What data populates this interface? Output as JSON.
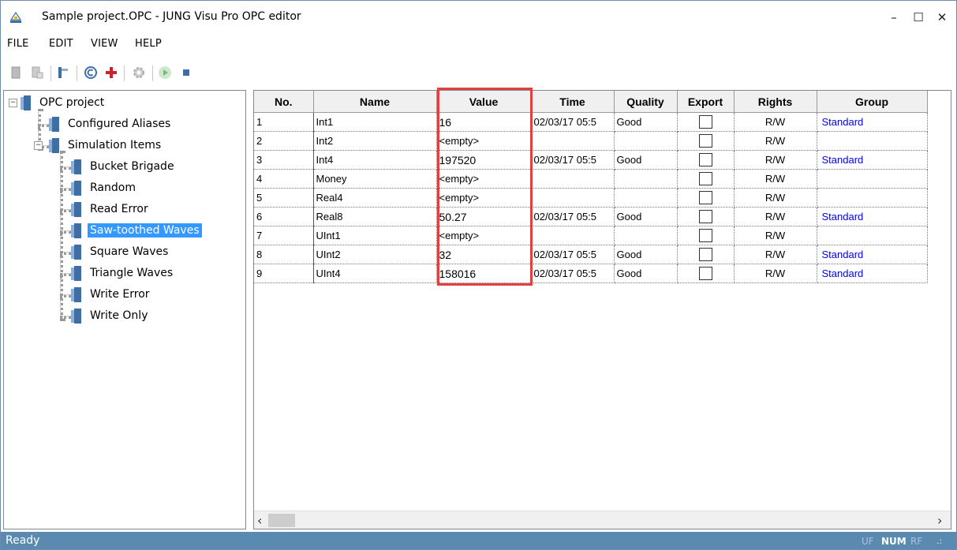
{
  "window": {
    "title": "Sample project.OPC - JUNG Visu Pro OPC editor",
    "minimize": "–",
    "maximize": "☐",
    "close": "✕"
  },
  "menu": [
    "FILE",
    "EDIT",
    "VIEW",
    "HELP"
  ],
  "toolbar": {
    "icons": [
      "new-icon",
      "open-icon",
      "save-icon",
      "copyright-icon",
      "add-icon",
      "settings-icon",
      "play-icon",
      "stop-icon"
    ]
  },
  "tree": {
    "root": "OPC project",
    "configured": "Configured Aliases",
    "simulation": "Simulation Items",
    "children": [
      "Bucket Brigade",
      "Random",
      "Read Error",
      "Saw-toothed Waves",
      "Square Waves",
      "Triangle Waves",
      "Write Error",
      "Write Only"
    ],
    "selected": "Saw-toothed Waves"
  },
  "table": {
    "columns": [
      "No.",
      "Name",
      "Value",
      "Time",
      "Quality",
      "Export",
      "Rights",
      "Group"
    ],
    "rows": [
      {
        "no": "1",
        "name": "Int1",
        "value": "16",
        "time": "02/03/17 05:5",
        "quality": "Good",
        "rights": "R/W",
        "group": "Standard"
      },
      {
        "no": "2",
        "name": "Int2",
        "value": "<empty>",
        "time": "",
        "quality": "",
        "rights": "R/W",
        "group": ""
      },
      {
        "no": "3",
        "name": "Int4",
        "value": "197520",
        "time": "02/03/17 05:5",
        "quality": "Good",
        "rights": "R/W",
        "group": "Standard"
      },
      {
        "no": "4",
        "name": "Money",
        "value": "<empty>",
        "time": "",
        "quality": "",
        "rights": "R/W",
        "group": ""
      },
      {
        "no": "5",
        "name": "Real4",
        "value": "<empty>",
        "time": "",
        "quality": "",
        "rights": "R/W",
        "group": ""
      },
      {
        "no": "6",
        "name": "Real8",
        "value": "50.27",
        "time": "02/03/17 05:5",
        "quality": "Good",
        "rights": "R/W",
        "group": "Standard"
      },
      {
        "no": "7",
        "name": "UInt1",
        "value": "<empty>",
        "time": "",
        "quality": "",
        "rights": "R/W",
        "group": ""
      },
      {
        "no": "8",
        "name": "UInt2",
        "value": "32",
        "time": "02/03/17 05:5",
        "quality": "Good",
        "rights": "R/W",
        "group": "Standard"
      },
      {
        "no": "9",
        "name": "UInt4",
        "value": "158016",
        "time": "02/03/17 05:5",
        "quality": "Good",
        "rights": "R/W",
        "group": "Standard"
      }
    ]
  },
  "scroll": {
    "left": "‹",
    "right": "›"
  },
  "status": {
    "text": "Ready",
    "indicators": [
      {
        "label": "UF",
        "active": false
      },
      {
        "label": "NUM",
        "active": true
      },
      {
        "label": "RF",
        "active": false
      }
    ]
  },
  "colors": {
    "statusbar": "#5b8ab1",
    "selection": "#3399ff",
    "highlight_box": "#e04040",
    "group_link": "#0000ee"
  }
}
